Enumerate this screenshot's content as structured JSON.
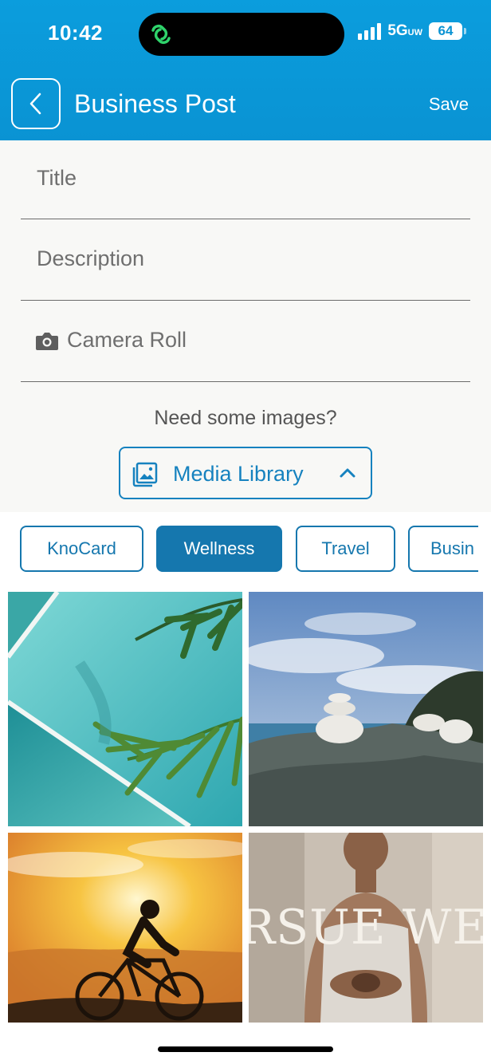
{
  "status_bar": {
    "time": "10:42",
    "network": "5G",
    "network_suffix": "UW",
    "battery": "64"
  },
  "nav": {
    "title": "Business Post",
    "save_label": "Save",
    "back_icon": "chevron-left-icon"
  },
  "form": {
    "title_placeholder": "Title",
    "description_placeholder": "Description",
    "camera_roll_label": "Camera Roll",
    "camera_icon": "camera-icon"
  },
  "media": {
    "prompt": "Need some images?",
    "button_label": "Media Library",
    "button_icon": "image-gallery-icon",
    "chevron_icon": "chevron-up-icon"
  },
  "categories": {
    "items": [
      "KnoCard",
      "Wellness",
      "Travel",
      "Busin"
    ],
    "selected": "Wellness"
  },
  "gallery": {
    "tiles": [
      {
        "name": "pool-palm-image"
      },
      {
        "name": "stacked-stones-image"
      },
      {
        "name": "sunset-cyclist-image"
      },
      {
        "name": "pursue-wellness-image",
        "overlay_text": "RSUE WELLNE"
      }
    ]
  },
  "colors": {
    "header": "#0a93d3",
    "accent": "#1577ae",
    "form_bg": "#f8f8f6"
  }
}
